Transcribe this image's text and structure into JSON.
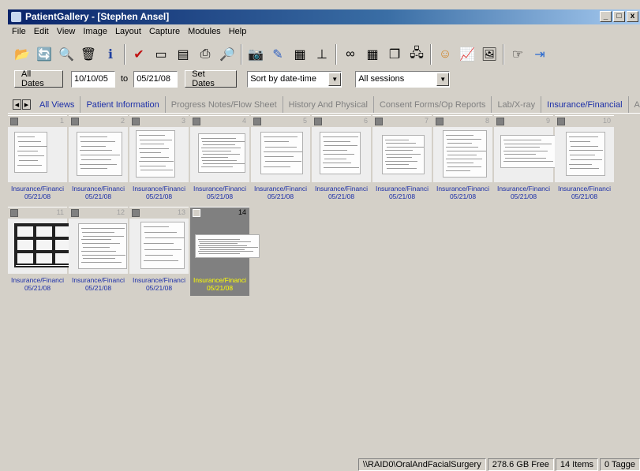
{
  "window": {
    "title": "PatientGallery - [Stephen Ansel]"
  },
  "window_buttons": {
    "minimize": "_",
    "maximize": "□",
    "close": "x"
  },
  "menu": [
    "File",
    "Edit",
    "View",
    "Image",
    "Layout",
    "Capture",
    "Modules",
    "Help"
  ],
  "toolbar_icons": [
    "open-folder-icon",
    "refresh-icon",
    "find-icon",
    "delete-icon",
    "info-icon",
    "checkmark-icon",
    "id-card-icon",
    "document-icon",
    "print-icon",
    "print-preview-icon",
    "camera-icon",
    "draw-tool-icon",
    "scanner-icon",
    "stamp-icon",
    "compare-icon",
    "layout-grid-icon",
    "window-icon",
    "network-icon",
    "patient-icon",
    "chart-icon",
    "image-icon",
    "pointer-icon",
    "exit-icon"
  ],
  "filters": {
    "all_dates_label": "All Dates",
    "from_date": "10/10/05",
    "to_label": "to",
    "to_date": "05/21/08",
    "set_dates_label": "Set Dates",
    "sort_value": "Sort by date-time",
    "session_value": "All sessions"
  },
  "tabs": [
    {
      "label": "All Views",
      "state": "active"
    },
    {
      "label": "Patient Information",
      "state": "blue"
    },
    {
      "label": "Progress Notes/Flow Sheet",
      "state": "muted"
    },
    {
      "label": "History And Physical",
      "state": "muted"
    },
    {
      "label": "Consent Forms/Op Reports",
      "state": "muted"
    },
    {
      "label": "Lab/X-ray",
      "state": "muted"
    },
    {
      "label": "Insurance/Financial",
      "state": "blue"
    },
    {
      "label": "Anesthesia",
      "state": "muted"
    }
  ],
  "thumbnails": [
    {
      "number": "1",
      "category": "Insurance/Financi",
      "date": "05/21/08"
    },
    {
      "number": "2",
      "category": "Insurance/Financi",
      "date": "05/21/08"
    },
    {
      "number": "3",
      "category": "Insurance/Financi",
      "date": "05/21/08"
    },
    {
      "number": "4",
      "category": "Insurance/Financi",
      "date": "05/21/08"
    },
    {
      "number": "5",
      "category": "Insurance/Financi",
      "date": "05/21/08"
    },
    {
      "number": "6",
      "category": "Insurance/Financi",
      "date": "05/21/08"
    },
    {
      "number": "7",
      "category": "Insurance/Financi",
      "date": "05/21/08"
    },
    {
      "number": "8",
      "category": "Insurance/Financi",
      "date": "05/21/08"
    },
    {
      "number": "9",
      "category": "Insurance/Financi",
      "date": "05/21/08"
    },
    {
      "number": "10",
      "category": "Insurance/Financi",
      "date": "05/21/08"
    },
    {
      "number": "11",
      "category": "Insurance/Financi",
      "date": "05/21/08"
    },
    {
      "number": "12",
      "category": "Insurance/Financi",
      "date": "05/21/08"
    },
    {
      "number": "13",
      "category": "Insurance/Financi",
      "date": "05/21/08"
    },
    {
      "number": "14",
      "category": "Insurance/Financi",
      "date": "05/21/08",
      "selected": true
    }
  ],
  "status": {
    "path": "\\\\RAID0\\OralAndFacialSurgery",
    "free_space": "278.6 GB Free",
    "items": "14 Items",
    "tagged": "0 Tagge"
  }
}
